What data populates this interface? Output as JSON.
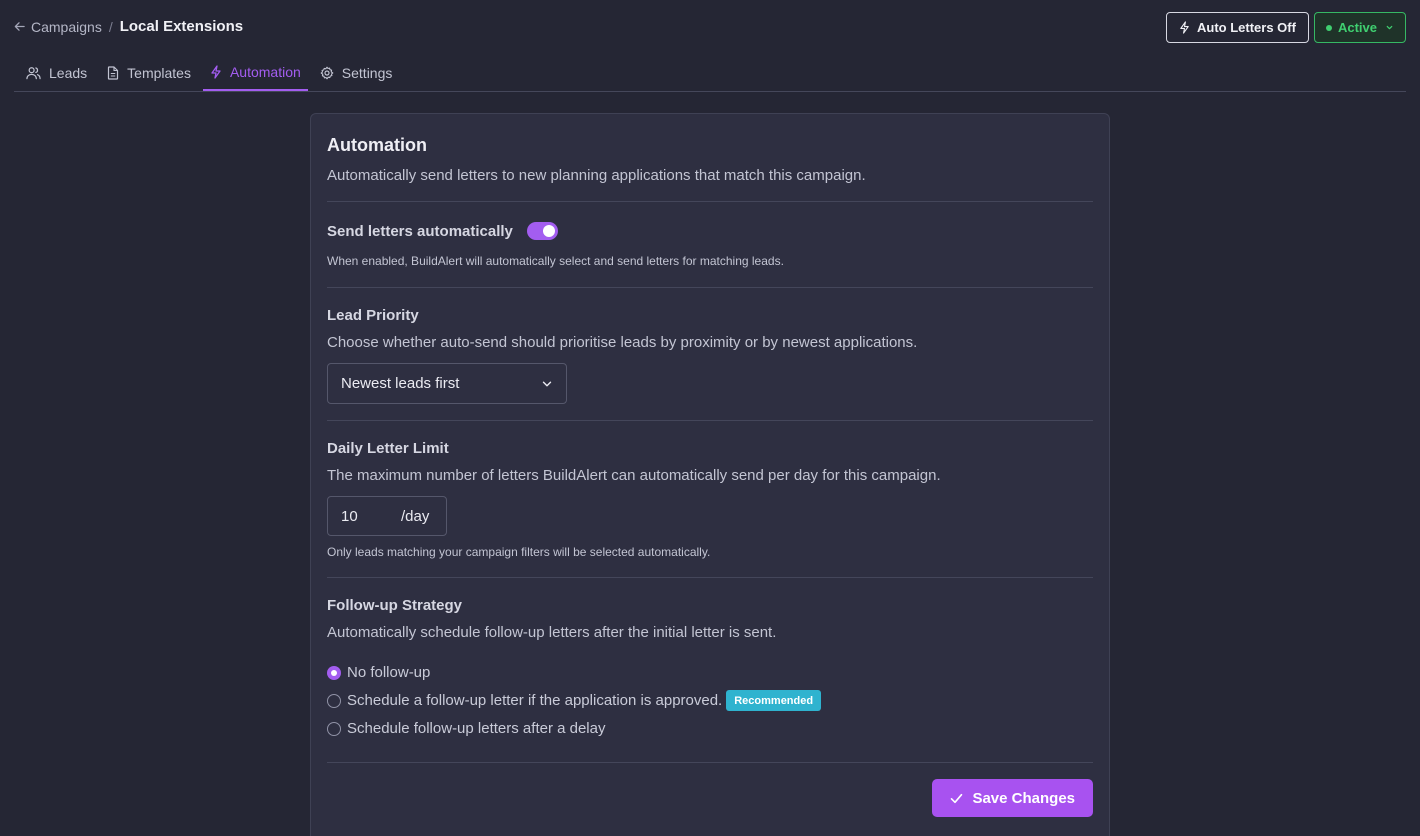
{
  "breadcrumb": {
    "parent": "Campaigns",
    "separator": "/",
    "current": "Local Extensions"
  },
  "header": {
    "auto_letters_label": "Auto Letters Off",
    "status_label": "Active",
    "status_color": "#3fcf70"
  },
  "tabs": [
    {
      "label": "Leads",
      "icon": "users-icon",
      "active": false
    },
    {
      "label": "Templates",
      "icon": "document-icon",
      "active": false
    },
    {
      "label": "Automation",
      "icon": "lightning-icon",
      "active": true
    },
    {
      "label": "Settings",
      "icon": "gear-icon",
      "active": false
    }
  ],
  "card": {
    "title": "Automation",
    "description": "Automatically send letters to new planning applications that match this campaign.",
    "auto_send": {
      "label": "Send letters automatically",
      "enabled": true,
      "help": "When enabled, BuildAlert will automatically select and send letters for matching leads."
    },
    "lead_priority": {
      "title": "Lead Priority",
      "description": "Choose whether auto-send should prioritise leads by proximity or by newest applications.",
      "selected": "Newest leads first"
    },
    "daily_limit": {
      "title": "Daily Letter Limit",
      "description": "The maximum number of letters BuildAlert can automatically send per day for this campaign.",
      "value": "10",
      "unit": "/day",
      "help": "Only leads matching your campaign filters will be selected automatically."
    },
    "followup": {
      "title": "Follow-up Strategy",
      "description": "Automatically schedule follow-up letters after the initial letter is sent.",
      "options": [
        {
          "label": "No follow-up",
          "checked": true
        },
        {
          "label": "Schedule a follow-up letter if the application is approved.",
          "checked": false,
          "badge": "Recommended"
        },
        {
          "label": "Schedule follow-up letters after a delay",
          "checked": false
        }
      ]
    },
    "save_label": "Save Changes"
  },
  "colors": {
    "accent": "#a35df0",
    "badge": "#2fb3cf",
    "background": "#252634",
    "card": "#2e2f41"
  }
}
